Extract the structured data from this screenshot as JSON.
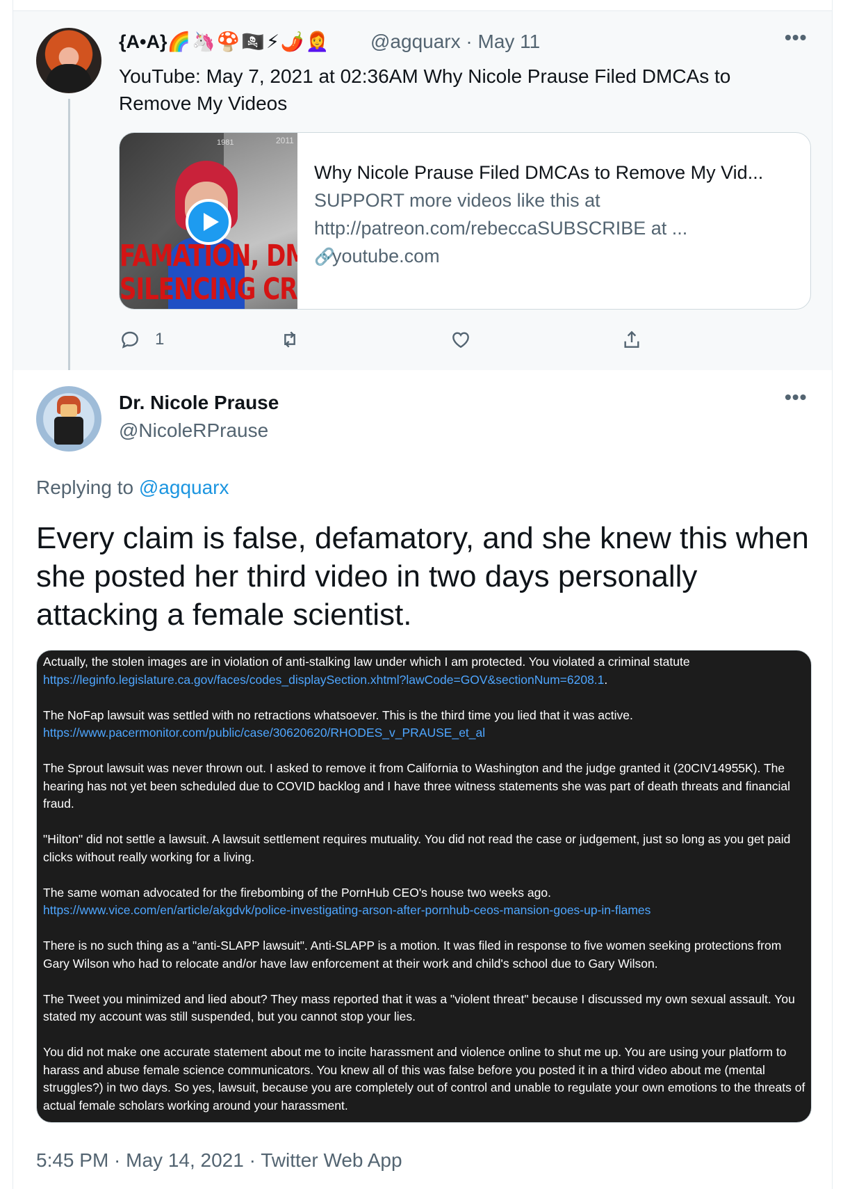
{
  "tweet1": {
    "display_name": "{A•A}",
    "name_emojis": "🌈🦄🍄🏴‍☠️⚡🌶️👩‍🦰",
    "handle": "@agquarx",
    "date": "May 11",
    "separator": " · ",
    "more_label": "•••",
    "text": "YouTube: May 7, 2021 at 02:36AM Why Nicole Prause Filed DMCAs to Remove My Videos",
    "card": {
      "title": "Why Nicole Prause Filed DMCAs to Remove My Vid...",
      "desc_line1": "SUPPORT more videos like this at",
      "desc_line2": "http://patreon.com/rebeccaSUBSCRIBE at ...",
      "domain": "youtube.com",
      "thumb_caption_1": "FAMATION, DMC",
      "thumb_caption_2": "SILENCING CRIT",
      "thumb_year_1": "1981",
      "thumb_year_2": "2011"
    },
    "reply_count": "1",
    "icons": [
      "reply-icon",
      "retweet-icon",
      "like-icon",
      "share-icon"
    ]
  },
  "tweet2": {
    "display_name": "Dr. Nicole Prause",
    "handle": "@NicoleRPrause",
    "more_label": "•••",
    "replying_prefix": "Replying to ",
    "replying_to": "@agquarx",
    "text": "Every claim is false, defamatory, and she knew this when she posted her third video in two days personally attacking a female scientist.",
    "screenshot": {
      "p1": "Actually, the stolen images are in violation of anti-stalking law under which I am protected. You violated a criminal statute",
      "p1_link": "https://leginfo.legislature.ca.gov/faces/codes_displaySection.xhtml?lawCode=GOV&sectionNum=6208.1",
      "p1_tail": ".",
      "p2": "The NoFap lawsuit was settled with no retractions whatsoever. This is the third time you lied that it was active.",
      "p2_link": "https://www.pacermonitor.com/public/case/30620620/RHODES_v_PRAUSE_et_al",
      "p3": "The Sprout lawsuit was never thrown out. I asked to remove it from California to Washington and the judge granted it (20CIV14955K). The hearing has not yet been scheduled due to COVID backlog and I have three witness statements she was part of death threats and financial fraud.",
      "p4": "\"Hilton\" did not settle a lawsuit.  A lawsuit settlement requires mutuality. You did not read the case or judgement, just so long as you get paid clicks without really working for a living.",
      "p5": "The same woman advocated for the firebombing of the PornHub CEO's house two weeks ago.",
      "p5_link": "https://www.vice.com/en/article/akgdvk/police-investigating-arson-after-pornhub-ceos-mansion-goes-up-in-flames",
      "p6": "There is no such thing as a \"anti-SLAPP lawsuit\". Anti-SLAPP is a motion. It was filed in response to five women seeking protections from Gary Wilson who had to relocate and/or have law enforcement at their work and child's school due to Gary Wilson.",
      "p7": "The Tweet you minimized and lied about? They mass reported that it was a \"violent threat\" because I discussed my own sexual assault. You stated my account was still suspended, but you cannot stop your lies.",
      "p8": "You did not make one accurate statement about me to incite harassment and violence online to shut me up. You are using your platform to harass and abuse female science communicators. You knew all of this was false before you posted it in a third video about me (mental struggles?) in two days.  So yes, lawsuit, because you are completely out of control and unable to regulate your own emotions to the threats of actual female scholars working around your harassment."
    },
    "footer": "5:45 PM · May 14, 2021 · Twitter Web App"
  },
  "colors": {
    "text": "#0f1419",
    "secondary": "#536471",
    "link": "#1b95e0",
    "play_button": "#1d9bf0",
    "thread_line": "#c4cfd6",
    "dark_screenshot_bg": "#1c1c1c"
  }
}
